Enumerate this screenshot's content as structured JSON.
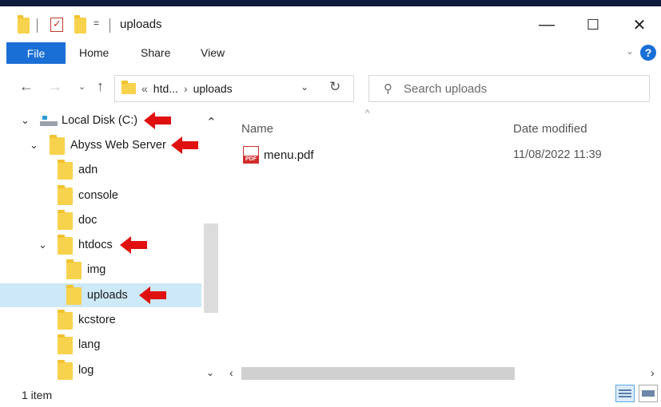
{
  "window": {
    "title": "uploads",
    "minimize": "—",
    "maximize": "☐",
    "close": "✕"
  },
  "ribbon": {
    "file": "File",
    "tabs": [
      "Home",
      "Share",
      "View"
    ],
    "help": "?"
  },
  "address": {
    "overflow": "«",
    "crumbs": [
      "htd...",
      "uploads"
    ],
    "separator": "›"
  },
  "search": {
    "placeholder": "Search uploads"
  },
  "tree": {
    "items": [
      {
        "label": "Local Disk (C:)",
        "icon": "drive-icon",
        "expanded": true
      },
      {
        "label": "Abyss Web Server",
        "icon": "folder-icon",
        "expanded": true
      },
      {
        "label": "adn",
        "icon": "folder-icon"
      },
      {
        "label": "console",
        "icon": "folder-icon"
      },
      {
        "label": "doc",
        "icon": "folder-icon"
      },
      {
        "label": "htdocs",
        "icon": "folder-icon",
        "expanded": true
      },
      {
        "label": "img",
        "icon": "folder-icon"
      },
      {
        "label": "uploads",
        "icon": "folder-icon",
        "selected": true
      },
      {
        "label": "kcstore",
        "icon": "folder-icon"
      },
      {
        "label": "lang",
        "icon": "folder-icon"
      },
      {
        "label": "log",
        "icon": "folder-icon"
      }
    ]
  },
  "files": {
    "columns": {
      "name": "Name",
      "date": "Date modified"
    },
    "rows": [
      {
        "name": "menu.pdf",
        "date": "11/08/2022 11:39",
        "icon": "pdf-icon",
        "icon_text": "PDF"
      }
    ]
  },
  "status": {
    "count": "1 item"
  },
  "colors": {
    "accent": "#1a6fd6",
    "selection": "#cde8f6",
    "arrow": "#e01010",
    "folder": "#f7d24d"
  }
}
